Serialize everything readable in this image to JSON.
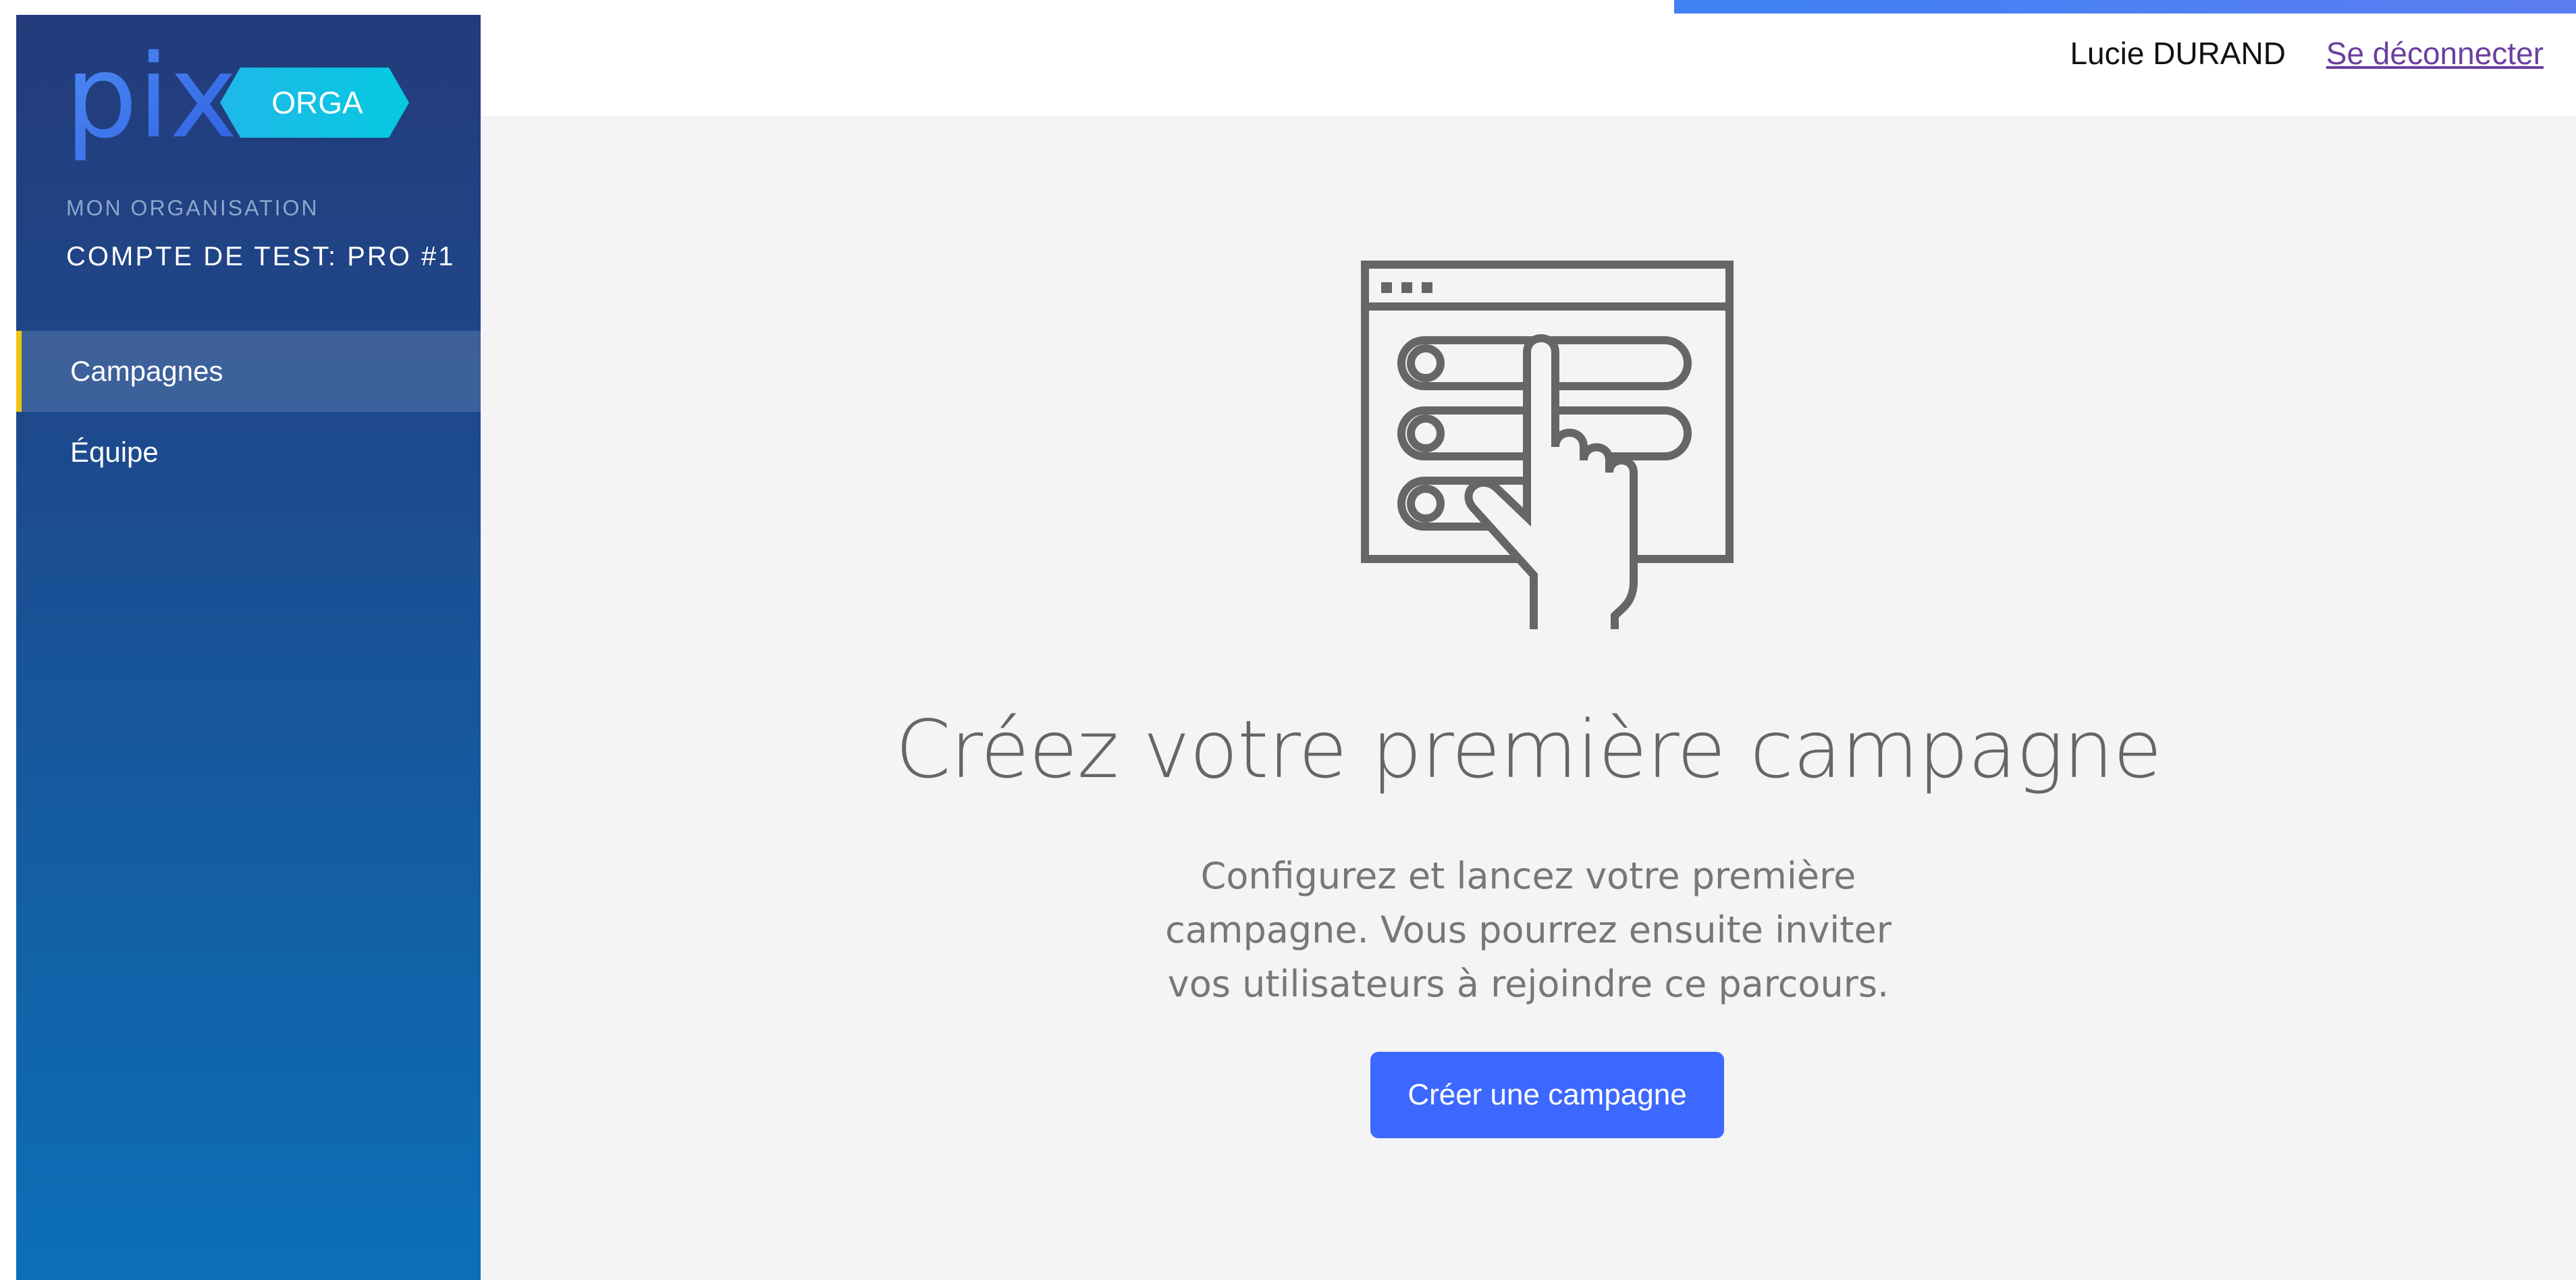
{
  "sidebar": {
    "logo": {
      "brand": "pix",
      "badge": "ORGA"
    },
    "org_label": "MON ORGANISATION",
    "org_name": "COMPTE DE TEST: PRO #1",
    "items": [
      {
        "label": "Campagnes",
        "active": true
      },
      {
        "label": "Équipe",
        "active": false
      }
    ]
  },
  "header": {
    "user_name": "Lucie DURAND",
    "logout_label": "Se déconnecter"
  },
  "main": {
    "title": "Créez votre première campagne",
    "description": "Configurez et lancez votre première campagne. Vous pourrez ensuite inviter vos utilisateurs à rejoindre ce parcours.",
    "cta_label": "Créer une campagne",
    "illustration_icon": "browser-hand-pointer-icon"
  },
  "colors": {
    "sidebar_top": "#233b7a",
    "sidebar_bottom": "#0b6fb7",
    "active_marker": "#f1c40f",
    "primary_button": "#3d68ff",
    "logout_link": "#6b3fa0"
  }
}
